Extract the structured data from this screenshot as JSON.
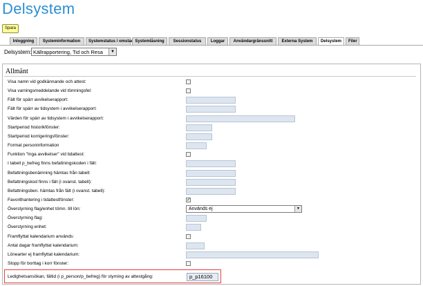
{
  "header": {
    "title": "Delsystem",
    "save_label": "Spara"
  },
  "tabs": [
    {
      "label": "Inloggning",
      "active": false
    },
    {
      "label": "Systeminformation",
      "active": false
    },
    {
      "label": "Systemstatus / omstart",
      "active": false
    },
    {
      "label": "Systemlåsning",
      "active": false
    },
    {
      "label": "Sessionstatus",
      "active": false
    },
    {
      "label": "Loggar",
      "active": false
    },
    {
      "label": "Användargränssnitt",
      "active": false
    },
    {
      "label": "Externa System",
      "active": false
    },
    {
      "label": "Delsystem",
      "active": true
    },
    {
      "label": "Filer",
      "active": false
    }
  ],
  "subsystem": {
    "label": "Delsystem:",
    "selected": "Källrapportering, Tid och Resa"
  },
  "section": {
    "title": "Allmänt"
  },
  "rows": [
    {
      "label": "Visa namn vid godkännande och attest:",
      "type": "checkbox",
      "checked": false
    },
    {
      "label": "Visa varningsmeddelande vid tömningsfel:",
      "type": "checkbox",
      "checked": false
    },
    {
      "label": "Fält för spärr avvikelserapport:",
      "type": "text",
      "value": ""
    },
    {
      "label": "Fält för spärr av tidsystem i avvikelserapport:",
      "type": "text",
      "value": ""
    },
    {
      "label": "Värden för spärr av tidsystem i avvikelserapport:",
      "type": "text",
      "value": ""
    },
    {
      "label": "Startperiod historikfönster:",
      "type": "text",
      "value": ""
    },
    {
      "label": "Startperiod korrigeringsfönster:",
      "type": "text",
      "value": ""
    },
    {
      "label": "Format personinformation",
      "type": "text",
      "value": ""
    },
    {
      "label": "Funktion \"Inga avvikelser\" vid tidattest:",
      "type": "checkbox",
      "checked": false
    },
    {
      "label": "I tabell p_befreg finns befattningskoden i fält:",
      "type": "text",
      "value": ""
    },
    {
      "label": "Befattningsbenämning hämtas från tabell:",
      "type": "text",
      "value": ""
    },
    {
      "label": "Befattningskod finns i fält (i ovanst. tabell):",
      "type": "text",
      "value": ""
    },
    {
      "label": "Befattningsben. hämtas från fält (i ovanst. tabell):",
      "type": "text",
      "value": ""
    },
    {
      "label": "Favorithantering i tidattestfönster:",
      "type": "checkbox",
      "checked": true
    },
    {
      "label": "Överstyrning flag/enhet tömn. till lön:",
      "type": "select",
      "value": "Används ej"
    },
    {
      "label": "Överstyrning flag:",
      "type": "text",
      "value": ""
    },
    {
      "label": "Överstyrning enhet:",
      "type": "text",
      "value": ""
    },
    {
      "label": "Framflyttat kalendarium används:",
      "type": "checkbox",
      "checked": false
    },
    {
      "label": "Antal dagar framflyttat kalendarium:",
      "type": "text",
      "value": ""
    },
    {
      "label": "Lönearter ej framflyttat kalendarium:",
      "type": "text",
      "value": ""
    },
    {
      "label": "Stopp för borttag i korr fönster:",
      "type": "checkbox",
      "checked": false
    }
  ],
  "highlight_row": {
    "label": "Ledighetsansökan, fältid (i p_person/p_befreg) för styrning av attestgång:",
    "value": "p_p16100"
  }
}
